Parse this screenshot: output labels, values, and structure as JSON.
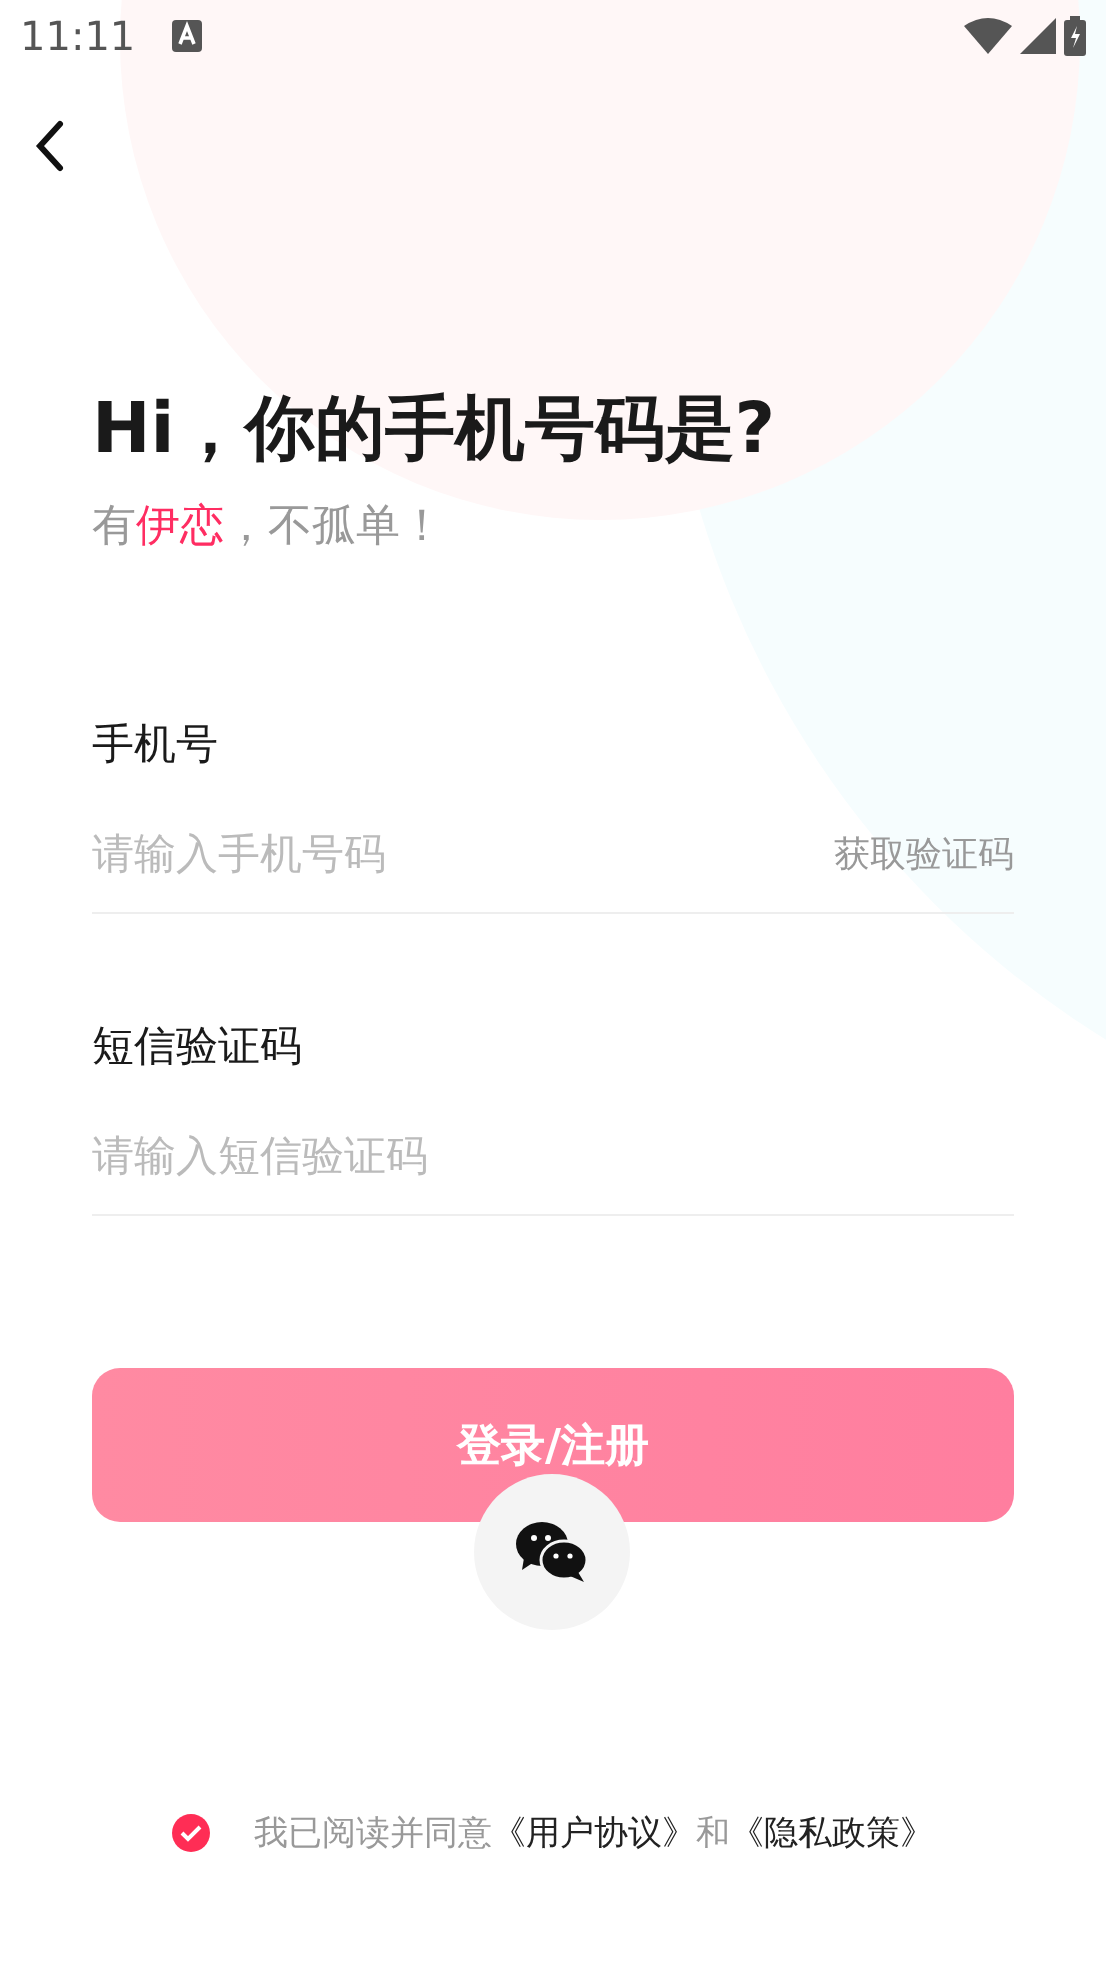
{
  "status_bar": {
    "time": "11:11"
  },
  "title": "Hi，你的手机号码是?",
  "subtitle": [
    {
      "text": "有",
      "highlight": false
    },
    {
      "text": "伊恋",
      "highlight": true
    },
    {
      "text": "，不孤单！",
      "highlight": false
    }
  ],
  "fields": [
    {
      "label": "手机号",
      "placeholder": "请输入手机号码",
      "action": "获取验证码"
    },
    {
      "label": "短信验证码",
      "placeholder": "请输入短信验证码"
    }
  ],
  "login_button": {
    "label": "登录/注册",
    "disabled": true
  },
  "agreement": {
    "checked": true,
    "segments": [
      {
        "text": "我已阅读并同意",
        "kind": "plain"
      },
      {
        "text": "《用户协议》",
        "kind": "link"
      },
      {
        "text": "和",
        "kind": "plain"
      },
      {
        "text": "《隐私政策》",
        "kind": "link"
      }
    ]
  }
}
